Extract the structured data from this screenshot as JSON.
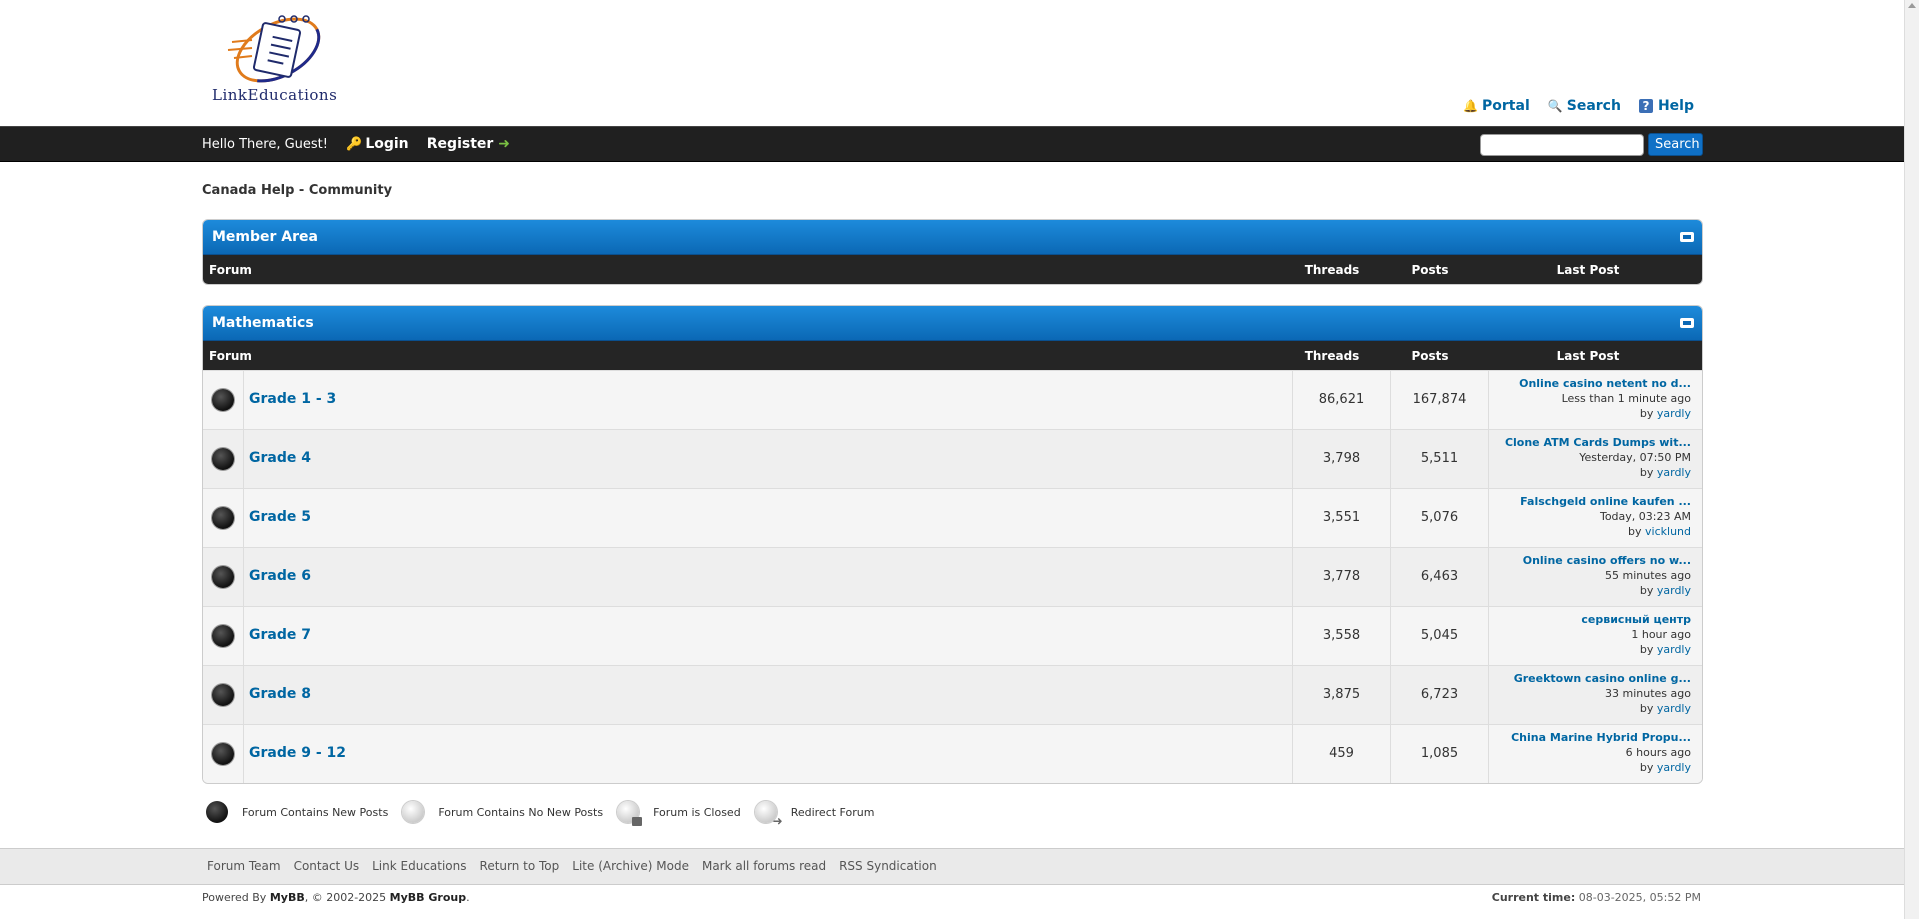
{
  "header": {
    "logo_text": "LinkEducations",
    "links": [
      {
        "label": "Portal",
        "icon": "bell-icon"
      },
      {
        "label": "Search",
        "icon": "magnifier-icon"
      },
      {
        "label": "Help",
        "icon": "help-book-icon"
      }
    ]
  },
  "panel": {
    "greeting": "Hello There, Guest!",
    "login": "Login",
    "register": "Register",
    "search_button": "Search",
    "search_value": ""
  },
  "breadcrumb": "Canada Help - Community",
  "categories": [
    {
      "title": "Member Area",
      "columns": {
        "forum": "Forum",
        "threads": "Threads",
        "posts": "Posts",
        "last_post": "Last Post"
      },
      "forums": []
    },
    {
      "title": "Mathematics",
      "columns": {
        "forum": "Forum",
        "threads": "Threads",
        "posts": "Posts",
        "last_post": "Last Post"
      },
      "forums": [
        {
          "name": "Grade 1 - 3",
          "threads": "86,621",
          "posts": "167,874",
          "last_title": "Online casino netent no d...",
          "last_time": "Less than 1 minute ago",
          "by": "by",
          "last_user": "yardly"
        },
        {
          "name": "Grade 4",
          "threads": "3,798",
          "posts": "5,511",
          "last_title": "Clone ATM Cards Dumps wit...",
          "last_time": "Yesterday, 07:50 PM",
          "by": "by",
          "last_user": "yardly"
        },
        {
          "name": "Grade 5",
          "threads": "3,551",
          "posts": "5,076",
          "last_title": "Falschgeld online kaufen ...",
          "last_time": "Today, 03:23 AM",
          "by": "by",
          "last_user": "vicklund"
        },
        {
          "name": "Grade 6",
          "threads": "3,778",
          "posts": "6,463",
          "last_title": "Online casino offers no w...",
          "last_time": "55 minutes ago",
          "by": "by",
          "last_user": "yardly"
        },
        {
          "name": "Grade 7",
          "threads": "3,558",
          "posts": "5,045",
          "last_title": "сервисный центр",
          "last_time": "1 hour ago",
          "by": "by",
          "last_user": "yardly"
        },
        {
          "name": "Grade 8",
          "threads": "3,875",
          "posts": "6,723",
          "last_title": "Greektown casino online g...",
          "last_time": "33 minutes ago",
          "by": "by",
          "last_user": "yardly"
        },
        {
          "name": "Grade 9 - 12",
          "threads": "459",
          "posts": "1,085",
          "last_title": "China Marine Hybrid Propu...",
          "last_time": "6 hours ago",
          "by": "by",
          "last_user": "yardly"
        }
      ]
    }
  ],
  "legend": [
    {
      "label": "Forum Contains New Posts",
      "icon": "forum-new-icon"
    },
    {
      "label": "Forum Contains No New Posts",
      "icon": "forum-no-new-icon"
    },
    {
      "label": "Forum is Closed",
      "icon": "forum-closed-icon"
    },
    {
      "label": "Redirect Forum",
      "icon": "forum-redirect-icon"
    }
  ],
  "footer": {
    "links": [
      "Forum Team",
      "Contact Us",
      "Link Educations",
      "Return to Top",
      "Lite (Archive) Mode",
      "Mark all forums read",
      "RSS Syndication"
    ],
    "powered_prefix": "Powered By",
    "mybb": "MyBB",
    "copyright_mid": ", © 2002-2025",
    "mybb_group": "MyBB Group",
    "copyright_end": ".",
    "current_time_label": "Current time:",
    "current_time": "08-03-2025, 05:52 PM"
  },
  "colors": {
    "accent": "#0f70c6",
    "link": "#0066a2",
    "panel_bg": "#202020",
    "category_header": "#0b68b5"
  }
}
